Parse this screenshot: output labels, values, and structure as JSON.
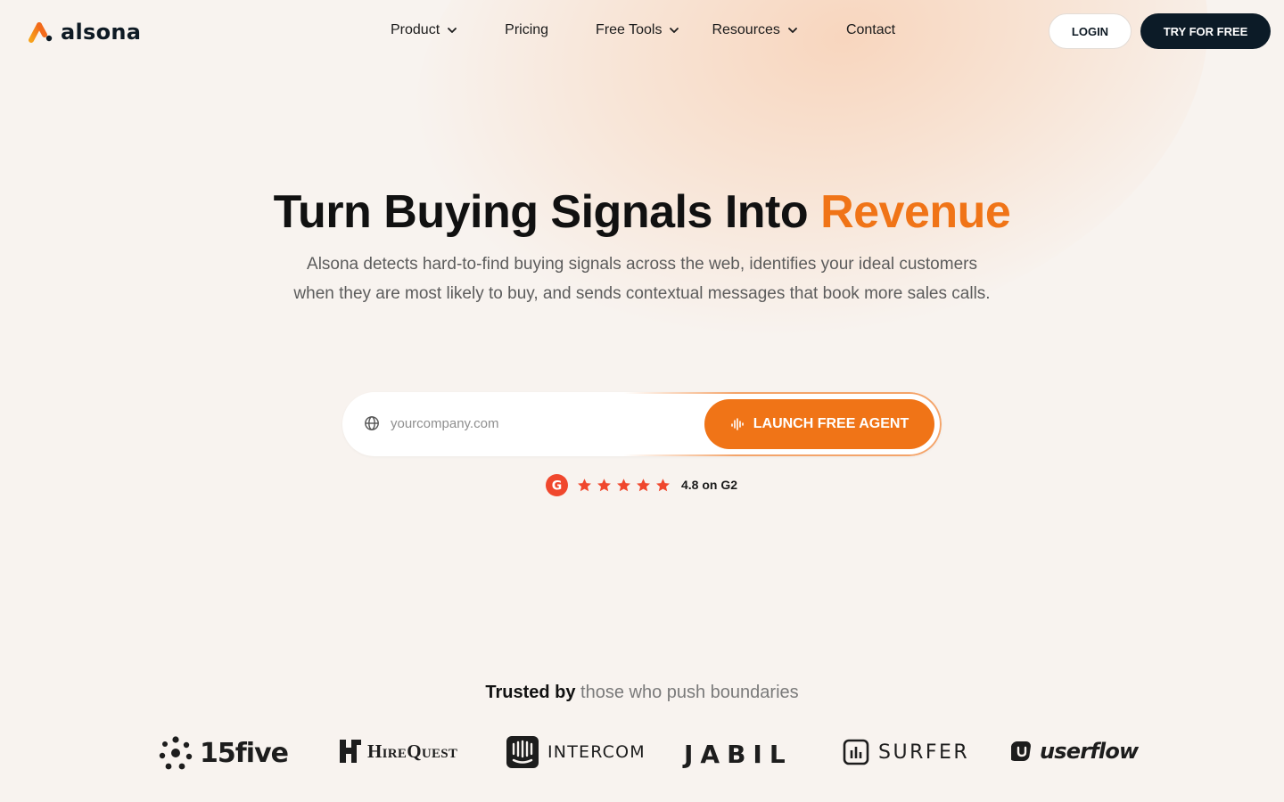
{
  "brand": {
    "name": "alsona",
    "accent_color": "#f07417",
    "dark_color": "#0c1b27"
  },
  "nav": {
    "items": [
      {
        "label": "Product",
        "has_dropdown": true
      },
      {
        "label": "Pricing",
        "has_dropdown": false
      },
      {
        "label": "Free Tools",
        "has_dropdown": true
      },
      {
        "label": "Resources",
        "has_dropdown": true
      },
      {
        "label": "Contact",
        "has_dropdown": false
      }
    ],
    "login_label": "LOGIN",
    "try_label": "TRY FOR FREE"
  },
  "hero": {
    "title_main": "Turn Buying Signals Into ",
    "title_accent": "Revenue",
    "subtitle_line1": "Alsona detects hard-to-find buying signals across the web, identifies your ideal customers",
    "subtitle_line2": "when they are most likely to buy, and sends contextual messages that book more sales calls."
  },
  "search": {
    "placeholder": "yourcompany.com",
    "value": "",
    "button_label": "LAUNCH FREE AGENT",
    "icon": "globe-icon",
    "button_icon": "waveform-icon"
  },
  "rating": {
    "source_icon": "g2-logo",
    "stars": 5,
    "text": "4.8 on G2",
    "star_color": "#f0472d"
  },
  "trusted": {
    "bold": "Trusted by",
    "rest": "those who push boundaries"
  },
  "logos": [
    {
      "name": "15five",
      "label": "15five"
    },
    {
      "name": "hirequest",
      "label": "HireQuest"
    },
    {
      "name": "intercom",
      "label": "INTERCOM"
    },
    {
      "name": "jabil",
      "label": "JABIL"
    },
    {
      "name": "surfer",
      "label": "SURFER"
    },
    {
      "name": "userflow",
      "label": "userflow"
    }
  ]
}
